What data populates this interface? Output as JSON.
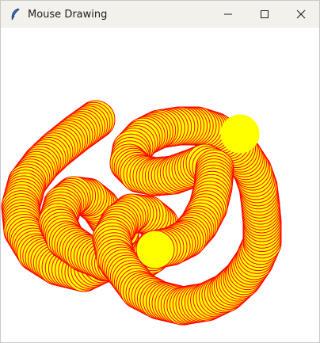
{
  "window": {
    "title": "Mouse Drawing",
    "icon": "feather-icon",
    "controls": [
      {
        "name": "minimize-button",
        "icon": "minimize-icon"
      },
      {
        "name": "maximize-button",
        "icon": "maximize-icon"
      },
      {
        "name": "close-button",
        "icon": "close-icon"
      }
    ]
  },
  "canvas": {
    "background": "#ffffff",
    "brush": {
      "shape": "circle",
      "fill": "#ffff00",
      "outline": "#ff0000"
    }
  }
}
